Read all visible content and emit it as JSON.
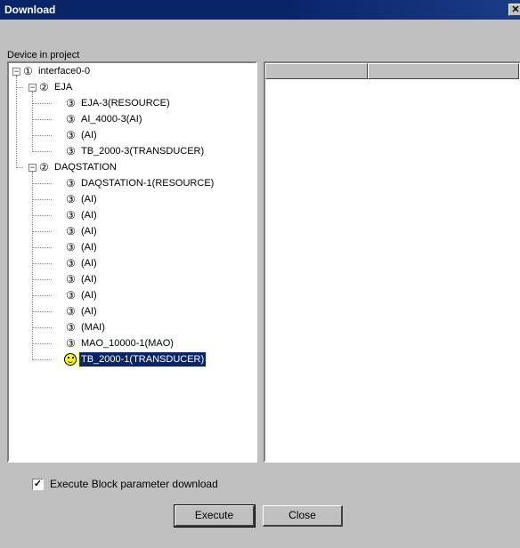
{
  "window": {
    "title": "Download",
    "close_glyph": "✕"
  },
  "device_group": {
    "label": "Device in project"
  },
  "tree": [
    {
      "num": "①",
      "label": "interface0-0",
      "level": 0,
      "expander": "⊟"
    },
    {
      "num": "②",
      "label": "EJA",
      "level": 1,
      "expander": "⊟"
    },
    {
      "num": "③",
      "label": "EJA-3(RESOURCE)",
      "level": 2
    },
    {
      "num": "③",
      "label": "AI_4000-3(AI)",
      "level": 2
    },
    {
      "num": "③",
      "label": "(AI)",
      "level": 2
    },
    {
      "num": "③",
      "label": "TB_2000-3(TRANSDUCER)",
      "level": 2
    },
    {
      "num": "②",
      "label": "DAQSTATION",
      "level": 1,
      "expander": "⊟"
    },
    {
      "num": "③",
      "label": "DAQSTATION-1(RESOURCE)",
      "level": 2
    },
    {
      "num": "③",
      "label": "(AI)",
      "level": 2
    },
    {
      "num": "③",
      "label": "(AI)",
      "level": 2
    },
    {
      "num": "③",
      "label": "(AI)",
      "level": 2
    },
    {
      "num": "③",
      "label": "(AI)",
      "level": 2
    },
    {
      "num": "③",
      "label": "(AI)",
      "level": 2
    },
    {
      "num": "③",
      "label": "(AI)",
      "level": 2
    },
    {
      "num": "③",
      "label": "(AI)",
      "level": 2
    },
    {
      "num": "③",
      "label": "(AI)",
      "level": 2
    },
    {
      "num": "③",
      "label": "(MAI)",
      "level": 2
    },
    {
      "num": "③",
      "label": "MAO_10000-1(MAO)",
      "level": 2
    },
    {
      "num": "smiley-icon",
      "label": "TB_2000-1(TRANSDUCER)",
      "level": 2,
      "selected": true
    }
  ],
  "list": {
    "columns": [
      "",
      ""
    ]
  },
  "options": {
    "execute_block_checkbox": {
      "label": "Execute Block parameter download",
      "checked": true,
      "check_glyph": "✓"
    }
  },
  "buttons": {
    "execute": "Execute",
    "close": "Close"
  },
  "colors": {
    "titlebar": "#0a246a",
    "selection": "#0a246a",
    "face": "#c0c0c0"
  }
}
